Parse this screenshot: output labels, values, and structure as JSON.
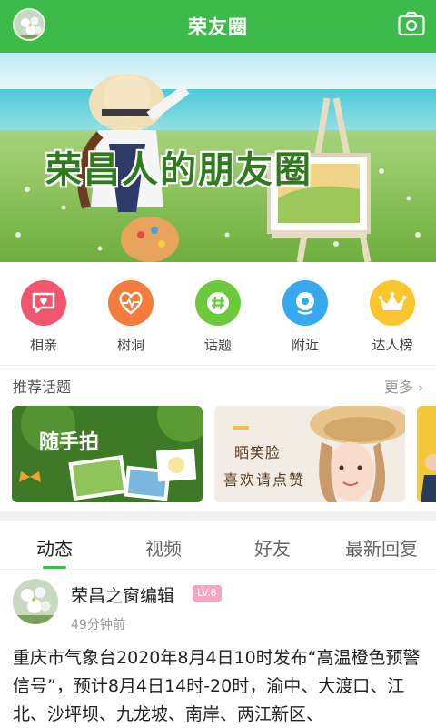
{
  "header": {
    "title": "荣友圈",
    "avatar_icon": "flower-avatar-icon",
    "camera_icon": "camera-icon"
  },
  "banner": {
    "text": "荣昌人的朋友圈"
  },
  "quick_nav": [
    {
      "label": "相亲",
      "icon": "chat-bubble-heart-icon",
      "color": "#f0566e"
    },
    {
      "label": "树洞",
      "icon": "heart-pulse-icon",
      "color": "#f47c3c"
    },
    {
      "label": "话题",
      "icon": "hashtag-icon",
      "color": "#6cc93b"
    },
    {
      "label": "附近",
      "icon": "location-icon",
      "color": "#35a8f0"
    },
    {
      "label": "达人榜",
      "icon": "crown-icon",
      "color": "#f9c62d"
    }
  ],
  "recommended": {
    "title": "推荐话题",
    "more": "更多",
    "cards": [
      {
        "text": "随手拍"
      },
      {
        "line1": "晒笑脸",
        "line2": "喜欢请点赞"
      }
    ]
  },
  "tabs": [
    {
      "label": "动态",
      "active": true
    },
    {
      "label": "视频",
      "active": false
    },
    {
      "label": "好友",
      "active": false
    },
    {
      "label": "最新回复",
      "active": false
    }
  ],
  "post": {
    "author": "荣昌之窗编辑",
    "level": "LV.8",
    "time": "49分钟前",
    "content": "重庆市气象台2020年8月4日10时发布“高温橙色预警信号”，预计8月4日14时-20时，渝中、大渡口、江北、沙坪坝、九龙坡、南岸、两江新区、"
  },
  "colors": {
    "brand_green": "#3dbb4a",
    "level_pink": "#f7a6c2"
  }
}
